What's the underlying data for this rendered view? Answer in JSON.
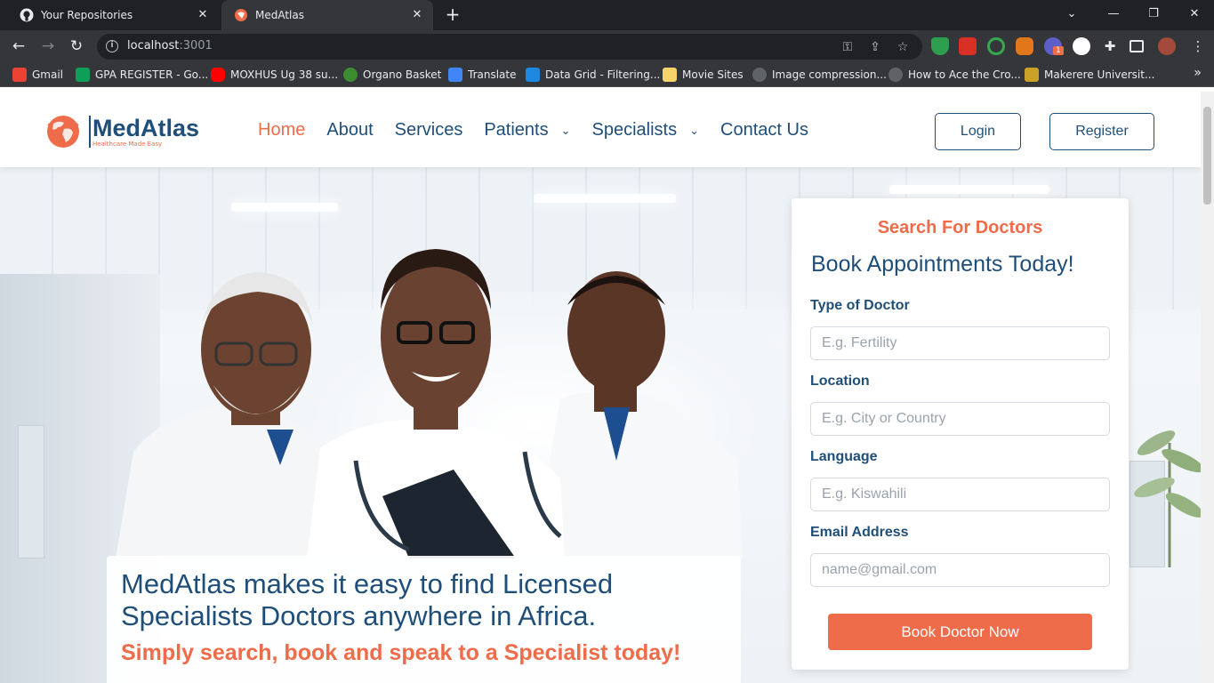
{
  "browser": {
    "tabs": [
      {
        "title": "Your Repositories",
        "icon": "github-icon",
        "active": false
      },
      {
        "title": "MedAtlas",
        "icon": "medatlas-favicon",
        "active": true
      }
    ],
    "url_host": "localhost",
    "url_port": ":3001",
    "bookmarks": [
      {
        "label": "Gmail",
        "icon": "gmail-icon",
        "color": "#ea4335"
      },
      {
        "label": "GPA REGISTER - Go...",
        "icon": "sheets-icon",
        "color": "#0f9d58"
      },
      {
        "label": "MOXHUS Ug 38 su...",
        "icon": "youtube-icon",
        "color": "#ff0000"
      },
      {
        "label": "Organo Basket",
        "icon": "organo-icon",
        "color": "#3c8d2f"
      },
      {
        "label": "Translate",
        "icon": "translate-icon",
        "color": "#4285f4"
      },
      {
        "label": "Data Grid - Filtering...",
        "icon": "mui-icon",
        "color": "#1e88e5"
      },
      {
        "label": "Movie Sites",
        "icon": "folder-icon",
        "color": "#f6d36b"
      },
      {
        "label": "Image compression...",
        "icon": "github-icon",
        "color": "#5f6368"
      },
      {
        "label": "How to Ace the Cro...",
        "icon": "link-icon",
        "color": "#5f6368"
      },
      {
        "label": "Makerere Universit...",
        "icon": "makerere-icon",
        "color": "#c9a227"
      }
    ],
    "extension_badge": "1"
  },
  "site": {
    "logo": {
      "name": "MedAtlas",
      "tagline": "Healthcare Made Easy"
    },
    "nav": [
      {
        "label": "Home",
        "active": true,
        "dropdown": false
      },
      {
        "label": "About",
        "active": false,
        "dropdown": false
      },
      {
        "label": "Services",
        "active": false,
        "dropdown": false
      },
      {
        "label": "Patients",
        "active": false,
        "dropdown": true
      },
      {
        "label": "Specialists",
        "active": false,
        "dropdown": true
      },
      {
        "label": "Contact Us",
        "active": false,
        "dropdown": false
      }
    ],
    "login_label": "Login",
    "register_label": "Register",
    "colors": {
      "primary": "#1f4e79",
      "accent": "#ef6c4a"
    }
  },
  "hero": {
    "headline": "MedAtlas makes it easy to find Licensed Specialists Doctors anywhere in Africa.",
    "subheadline": "Simply search, book and speak to a Specialist today!"
  },
  "search": {
    "kicker": "Search For Doctors",
    "title": "Book Appointments Today!",
    "fields": [
      {
        "label": "Type of Doctor",
        "placeholder": "E.g. Fertility",
        "value": ""
      },
      {
        "label": "Location",
        "placeholder": "E.g. City or Country",
        "value": ""
      },
      {
        "label": "Language",
        "placeholder": "E.g. Kiswahili",
        "value": ""
      },
      {
        "label": "Email Address",
        "placeholder": "name@gmail.com",
        "value": ""
      }
    ],
    "submit_label": "Book Doctor Now"
  }
}
